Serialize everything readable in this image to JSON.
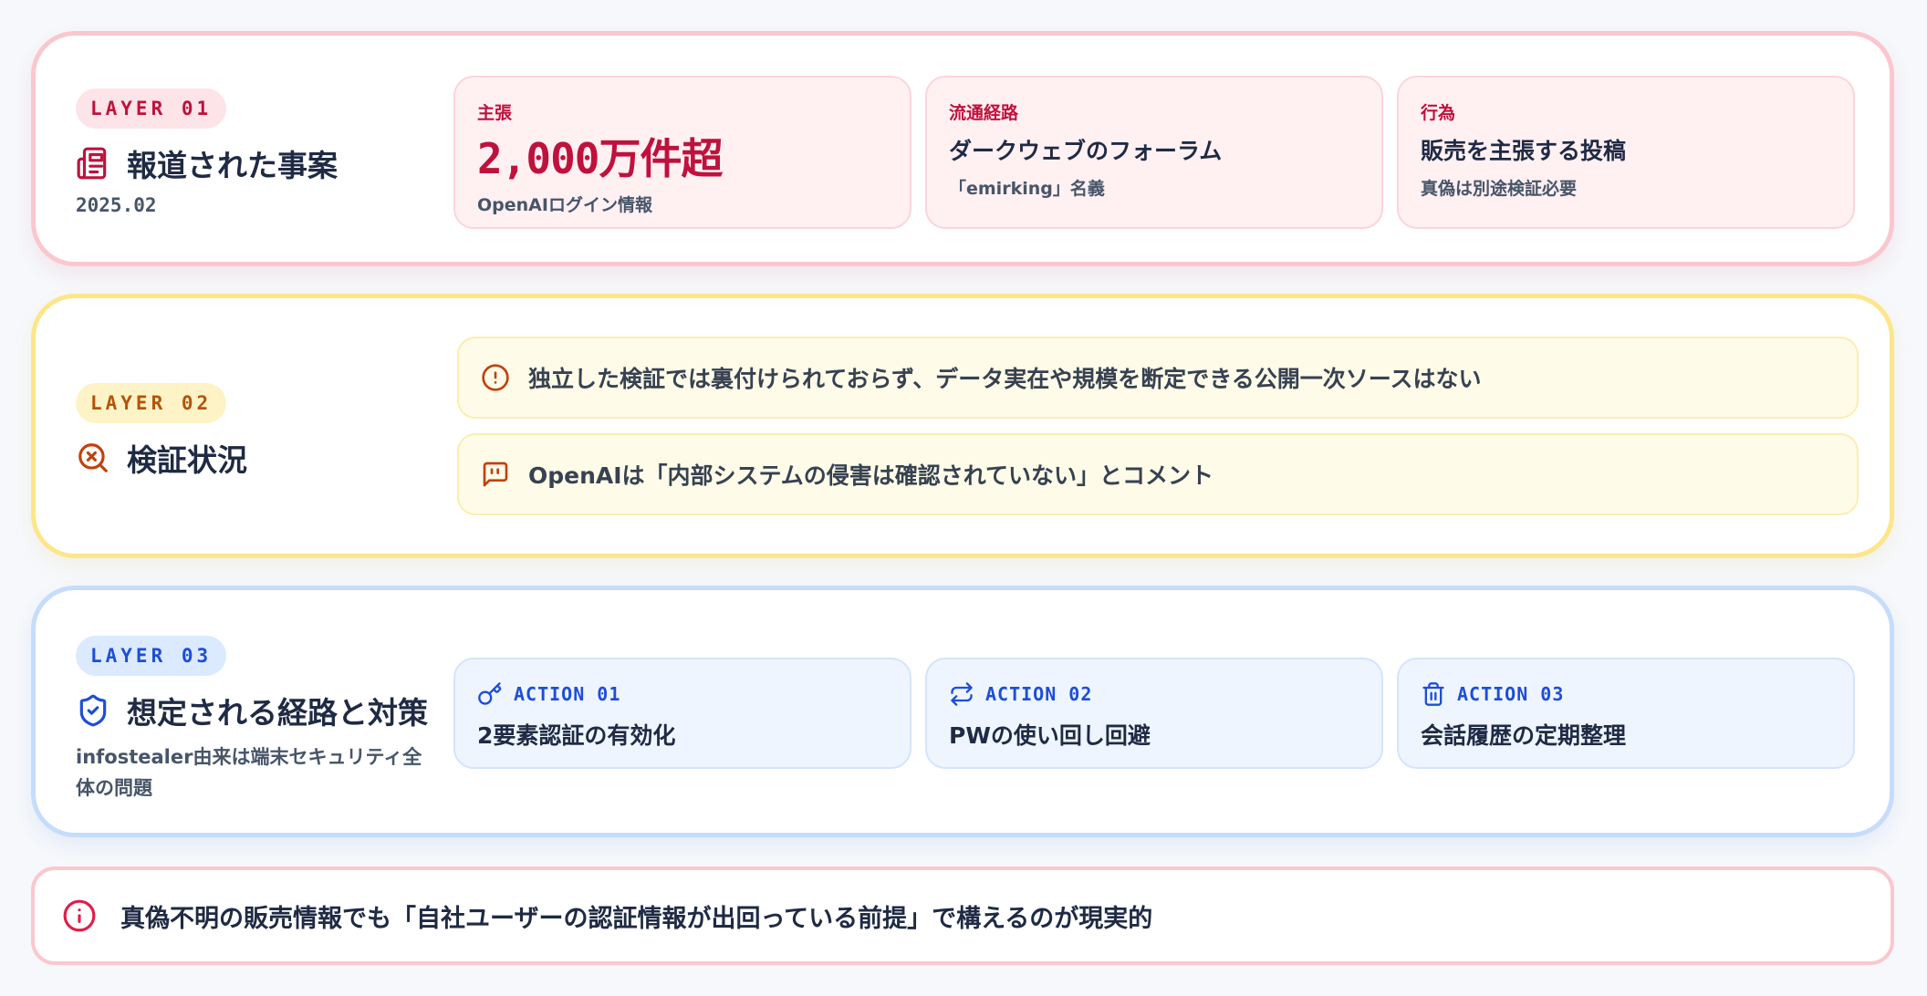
{
  "layer1": {
    "badge": "LAYER 01",
    "icon": "newspaper-icon",
    "title": "報道された事案",
    "date": "2025.02",
    "cards": [
      {
        "label": "主張",
        "big": "2,000万件超",
        "small": "OpenAIログイン情報"
      },
      {
        "label": "流通経路",
        "main": "ダークウェブのフォーラム",
        "small": "「emirking」名義"
      },
      {
        "label": "行為",
        "main": "販売を主張する投稿",
        "small": "真偽は別途検証必要"
      }
    ]
  },
  "layer2": {
    "badge": "LAYER 02",
    "icon": "search-x-icon",
    "title": "検証状況",
    "notes": [
      {
        "icon": "alert-circle-icon",
        "text": "独立した検証では裏付けられておらず、データ実在や規模を断定できる公開一次ソースはない"
      },
      {
        "icon": "quote-icon",
        "text": "OpenAIは「内部システムの侵害は確認されていない」とコメント"
      }
    ]
  },
  "layer3": {
    "badge": "LAYER 03",
    "icon": "shield-check-icon",
    "title": "想定される経路と対策",
    "note": "infostealer由来は端末セキュリティ全体の問題",
    "actions": [
      {
        "icon": "key-icon",
        "label": "ACTION 01",
        "text": "2要素認証の有効化"
      },
      {
        "icon": "repeat-icon",
        "label": "ACTION 02",
        "text": "PWの使い回し回避"
      },
      {
        "icon": "trash-icon",
        "label": "ACTION 03",
        "text": "会話履歴の定期整理"
      }
    ]
  },
  "conclusion": {
    "icon": "info-icon",
    "text": "真偽不明の販売情報でも「自社ユーザーの認証情報が出回っている前提」で構えるのが現実的"
  },
  "colors": {
    "pink_accent": "#be123c",
    "yellow_accent": "#b45309",
    "blue_accent": "#1d4ed8",
    "pink_border": "#fbc7cf",
    "yellow_border": "#fde68a",
    "blue_border": "#c6dcfb"
  }
}
